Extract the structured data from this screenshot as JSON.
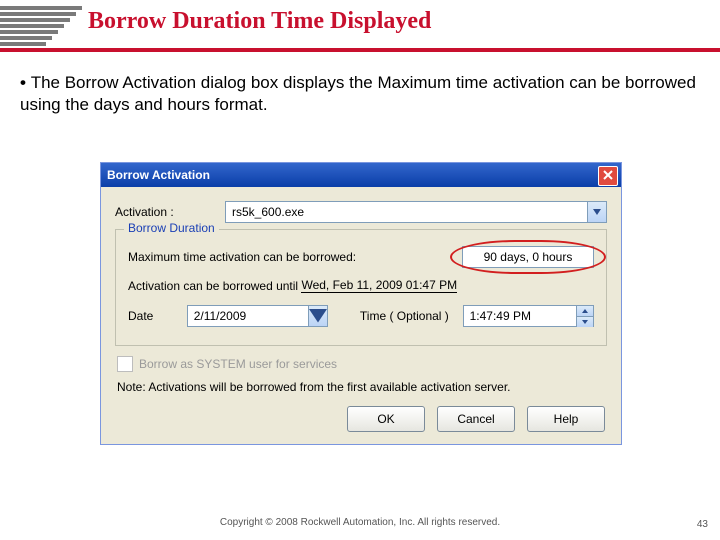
{
  "slide": {
    "title": "Borrow Duration Time Displayed",
    "bullet": "The Borrow Activation dialog box displays the Maximum time activation can be borrowed using the days and hours format.",
    "footer": "Copyright © 2008 Rockwell Automation, Inc. All rights reserved.",
    "page": "43"
  },
  "dialog": {
    "title": "Borrow Activation",
    "activation_label": "Activation :",
    "activation_value": "rs5k_600.exe",
    "duration": {
      "group_label": "Borrow Duration",
      "max_label": "Maximum time activation can be borrowed:",
      "max_value": "90 days, 0 hours",
      "until_label": "Activation can be borrowed until",
      "until_value": "Wed, Feb 11, 2009 01:47 PM",
      "date_label": "Date",
      "date_value": "2/11/2009",
      "time_label": "Time ( Optional )",
      "time_value": "1:47:49 PM"
    },
    "system_user_label": "Borrow as SYSTEM user for services",
    "note": "Note: Activations will be borrowed from the first available activation server.",
    "buttons": {
      "ok": "OK",
      "cancel": "Cancel",
      "help": "Help"
    }
  }
}
